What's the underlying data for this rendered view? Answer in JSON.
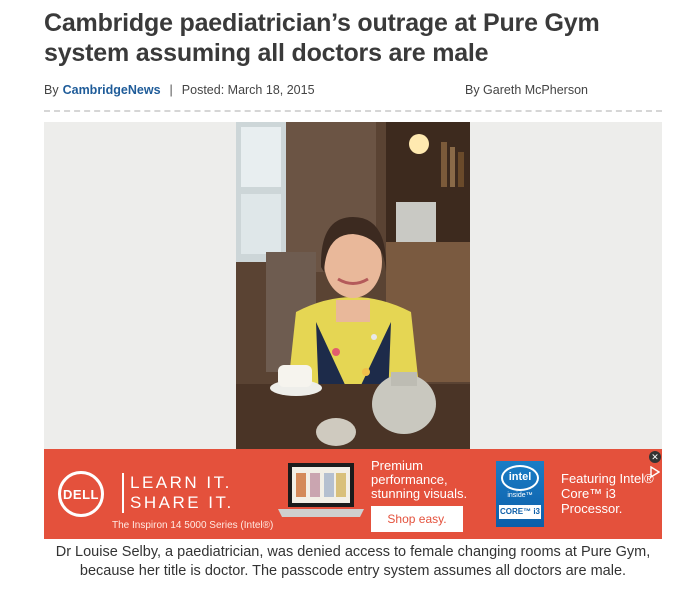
{
  "article": {
    "headline": "Cambridge paediatrician’s outrage at Pure Gym system assuming all doctors are male",
    "byline_prefix": "By",
    "source": "CambridgeNews",
    "separator": "|",
    "posted": "Posted: March 18, 2015",
    "author": "By Gareth McPherson",
    "caption": "Dr Louise Selby, a paediatrician, was denied access to female changing rooms at Pure Gym, because her title is doctor. The passcode entry system assumes all doctors are male."
  },
  "ad": {
    "brand_logo": "DELL",
    "line1": "LEARN IT.",
    "line2": "SHARE IT.",
    "series": "The Inspiron 14 5000 Series (Intel®)",
    "tagline": "Premium performance, stunning visuals.",
    "cta": "Shop easy.",
    "badge_brand": "intel",
    "badge_inside": "inside™",
    "badge_core": "CORE™ i3",
    "featuring": "Featuring Intel® Core™ i3 Processor.",
    "close_glyph": "✕",
    "accent": "#e4513c"
  },
  "icons": {
    "close": "close-icon",
    "adchoices": "adchoices-icon"
  }
}
